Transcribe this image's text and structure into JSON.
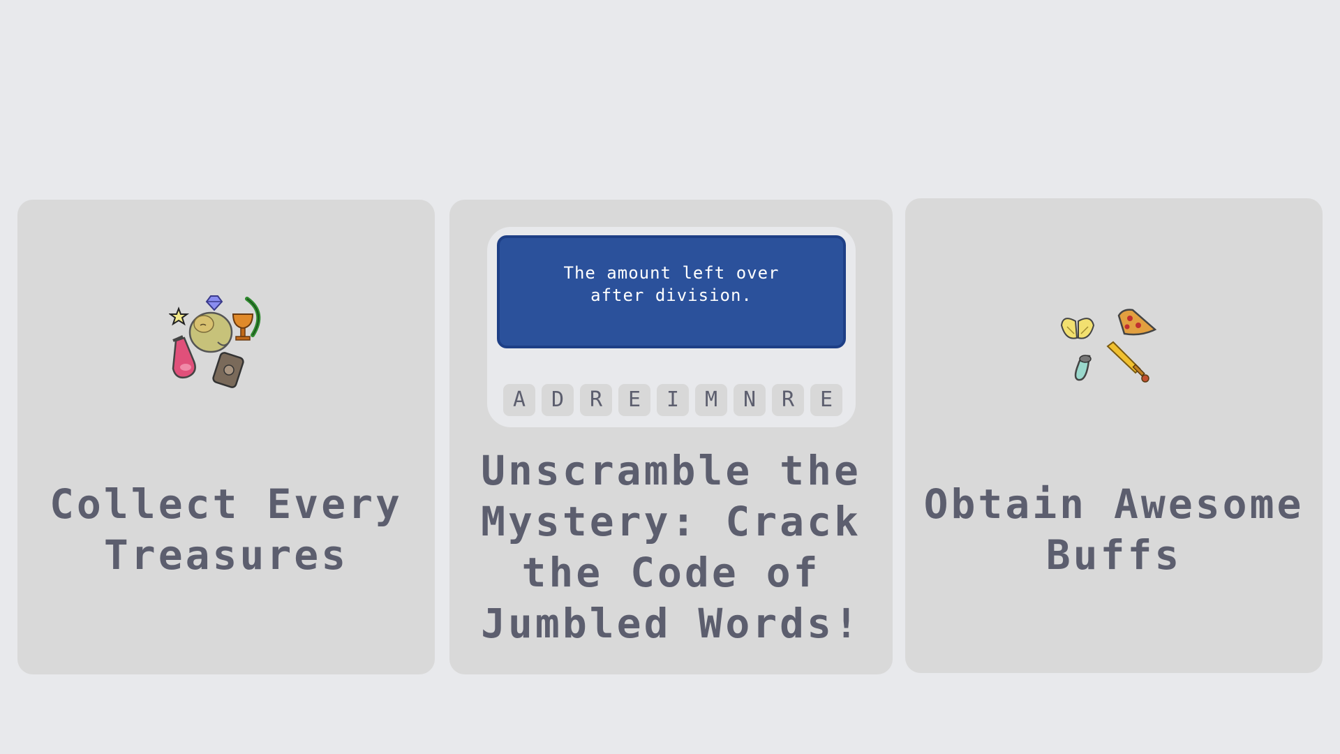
{
  "cards": [
    {
      "title": "Collect Every Treasures",
      "art_icons": [
        "star-icon",
        "gem-icon",
        "bow-icon",
        "mystery-creature-icon",
        "chalice-icon",
        "potion-icon",
        "spellbook-icon"
      ]
    },
    {
      "title": "Unscramble the Mystery: Crack the Code of Jumbled Words!",
      "clue": "The amount left over\nafter division.",
      "tiles": [
        "A",
        "D",
        "R",
        "E",
        "I",
        "M",
        "N",
        "R",
        "E"
      ]
    },
    {
      "title": "Obtain Awesome Buffs",
      "art_icons": [
        "angel-wings-icon",
        "pizza-slice-icon",
        "salt-shaker-icon",
        "golden-sword-icon"
      ]
    }
  ],
  "colors": {
    "page_background": "#e8e9ec",
    "card_background": "#d9d9d9",
    "title_text": "#5c5e6e",
    "clue_box": "#2b519b",
    "clue_text": "#ffffff"
  }
}
